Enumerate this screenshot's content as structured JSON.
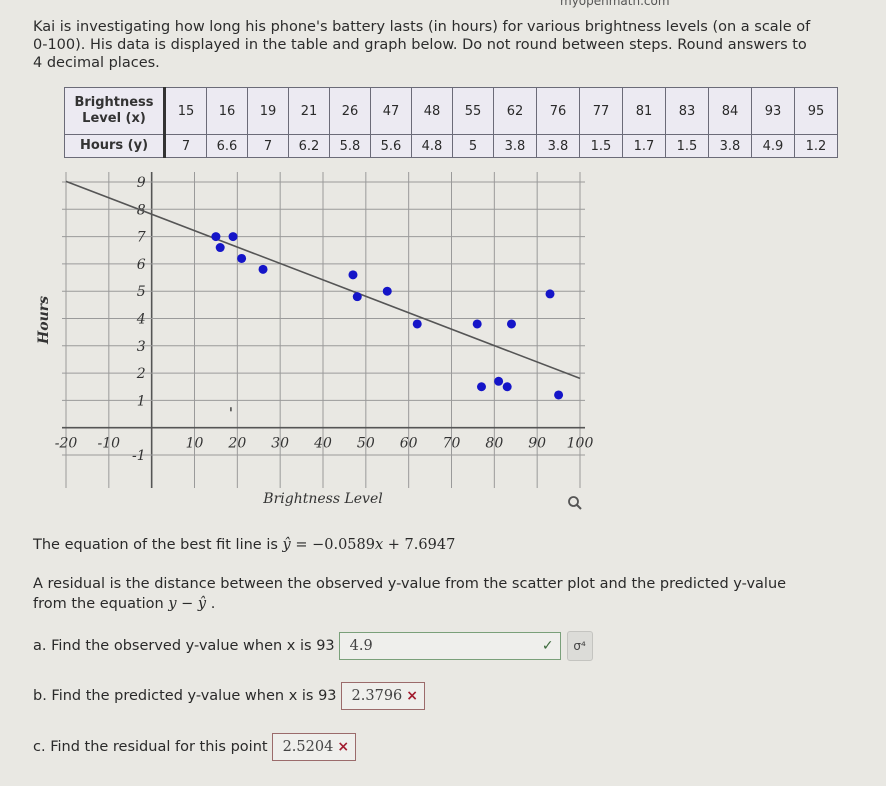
{
  "site_label": "myopenmath.com",
  "intro_text": "Kai is investigating how long his phone's battery lasts (in hours) for various brightness levels (on a scale of 0-100). His data is displayed in the table and graph below. Do not round between steps. Round answers to 4 decimal places.",
  "table": {
    "row1_header_line1": "Brightness",
    "row1_header_line2": "Level (x)",
    "row2_header": "Hours (y)",
    "x": [
      "15",
      "16",
      "19",
      "21",
      "26",
      "47",
      "48",
      "55",
      "62",
      "76",
      "77",
      "81",
      "83",
      "84",
      "93",
      "95"
    ],
    "y": [
      "7",
      "6.6",
      "7",
      "6.2",
      "5.8",
      "5.6",
      "4.8",
      "5",
      "3.8",
      "3.8",
      "1.5",
      "1.7",
      "1.5",
      "3.8",
      "4.9",
      "1.2"
    ]
  },
  "chart_data": {
    "type": "scatter",
    "title": "",
    "xlabel": "Brightness Level",
    "ylabel": "Hours",
    "xlim": [
      -20,
      100
    ],
    "ylim": [
      -1,
      9
    ],
    "x_ticks": [
      "-20",
      "-10",
      "10",
      "20",
      "30",
      "40",
      "50",
      "60",
      "70",
      "80",
      "90",
      "100"
    ],
    "x_tick_values": [
      -20,
      -10,
      10,
      20,
      30,
      40,
      50,
      60,
      70,
      80,
      90,
      100
    ],
    "y_ticks": [
      "-1",
      "1",
      "2",
      "3",
      "4",
      "5",
      "6",
      "7",
      "8",
      "9"
    ],
    "y_tick_values": [
      -1,
      1,
      2,
      3,
      4,
      5,
      6,
      7,
      8,
      9
    ],
    "grid": true,
    "points": [
      {
        "x": 15,
        "y": 7
      },
      {
        "x": 16,
        "y": 6.6
      },
      {
        "x": 19,
        "y": 7
      },
      {
        "x": 21,
        "y": 6.2
      },
      {
        "x": 26,
        "y": 5.8
      },
      {
        "x": 47,
        "y": 5.6
      },
      {
        "x": 48,
        "y": 4.8
      },
      {
        "x": 55,
        "y": 5
      },
      {
        "x": 62,
        "y": 3.8
      },
      {
        "x": 76,
        "y": 3.8
      },
      {
        "x": 77,
        "y": 1.5
      },
      {
        "x": 81,
        "y": 1.7
      },
      {
        "x": 83,
        "y": 1.5
      },
      {
        "x": 84,
        "y": 3.8
      },
      {
        "x": 93,
        "y": 4.9
      },
      {
        "x": 95,
        "y": 1.2
      }
    ],
    "trendline": {
      "slope": -0.0589,
      "intercept": 7.6947
    },
    "point_color": "#1515c8",
    "line_color": "#555555"
  },
  "equation": {
    "prefix": "The equation of the best fit line is ",
    "yhat": "ŷ",
    "rhs": " = −0.0589",
    "x": "x",
    "tail": " + 7.6947"
  },
  "residual": {
    "text": "A residual is the distance between the observed y-value from the scatter plot and the predicted y-value from the equation ",
    "y": "y",
    "minus": " − ",
    "yhat": "ŷ",
    "end": " ."
  },
  "questions": [
    {
      "label": "a.  Find the observed y-value when x is 93",
      "answer": "4.9",
      "status": "correct",
      "status_icon": "✓",
      "extra_button": "σ⁴"
    },
    {
      "label": "b.  Find the predicted y-value when x is 93",
      "answer": "2.3796",
      "status": "incorrect",
      "status_icon": "×"
    },
    {
      "label": "c.  Find the residual for this point",
      "answer": "2.5204",
      "status": "incorrect",
      "status_icon": "×"
    }
  ]
}
